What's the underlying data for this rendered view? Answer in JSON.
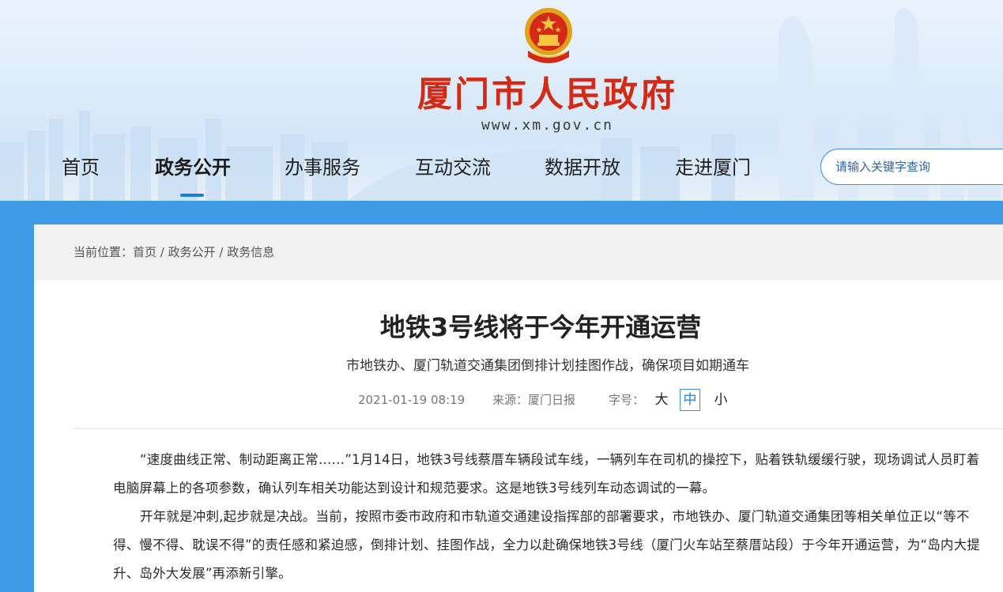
{
  "site": {
    "name": "厦门市人民政府",
    "url": "www.xm.gov.cn"
  },
  "nav": {
    "items": [
      {
        "label": "首页"
      },
      {
        "label": "政务公开"
      },
      {
        "label": "办事服务"
      },
      {
        "label": "互动交流"
      },
      {
        "label": "数据开放"
      },
      {
        "label": "走进厦门"
      }
    ],
    "active_index": 1
  },
  "search": {
    "placeholder": "请输入关键字查询"
  },
  "breadcrumb": {
    "prefix": "当前位置：",
    "items": [
      "首页",
      "政务公开",
      "政务信息"
    ],
    "separator": " / "
  },
  "article": {
    "title": "地铁3号线将于今年开通运营",
    "subtitle": "市地铁办、厦门轨道交通集团倒排计划挂图作战，确保项目如期通车",
    "datetime": "2021-01-19 08:19",
    "source_label": "来源：",
    "source": "厦门日报",
    "font_size_label": "字号：",
    "font_sizes": [
      "大",
      "中",
      "小"
    ],
    "selected_font_size": "中",
    "paragraphs": [
      "“速度曲线正常、制动距离正常……”1月14日，地铁3号线蔡厝车辆段试车线，一辆列车在司机的操控下，贴着铁轨缓缓行驶，现场调试人员盯着电脑屏幕上的各项参数，确认列车相关功能达到设计和规范要求。这是地铁3号线列车动态调试的一幕。",
      "开年就是冲刺,起步就是决战。当前，按照市委市政府和市轨道交通建设指挥部的部署要求，市地铁办、厦门轨道交通集团等相关单位正以“等不得、慢不得、耽误不得”的责任感和紧迫感，倒排计划、挂图作战，全力以赴确保地铁3号线（厦门火车站至蔡厝站段）于今年开通运营，为“岛内大提升、岛外大发展”再添新引擎。"
    ]
  },
  "colors": {
    "title_red": "#d32a18",
    "accent_blue": "#1a7ee0",
    "page_blue": "#3f9be6"
  }
}
